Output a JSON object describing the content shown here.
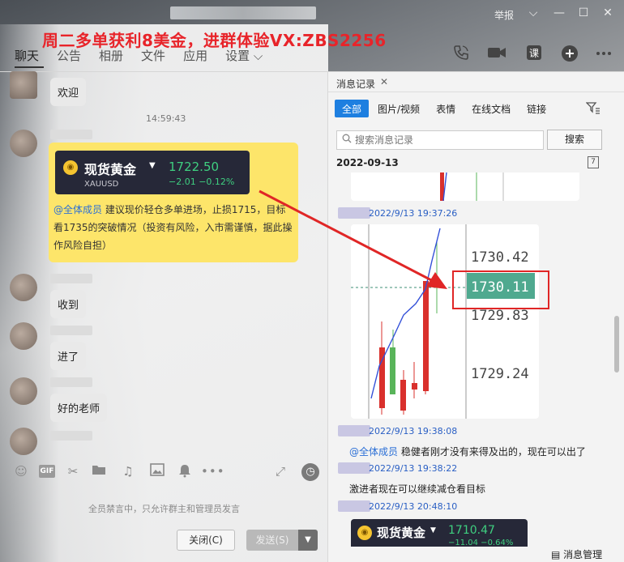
{
  "window": {
    "report_label": "举报",
    "controls": [
      "⌵",
      "—",
      "☐",
      "✕"
    ]
  },
  "promo_text": "周二多单获利8美金，进群体验VX:ZBS2256",
  "nav": {
    "tabs": [
      "聊天",
      "公告",
      "相册",
      "文件",
      "应用",
      "设置 ⌵"
    ]
  },
  "top_icons": [
    "phone-icon",
    "video-icon",
    "course-icon",
    "add-icon",
    "more-icon"
  ],
  "chat": {
    "messages": [
      {
        "text": "欢迎"
      },
      {
        "time": "14:59:43"
      },
      {
        "text": "收到"
      },
      {
        "text": "进了"
      },
      {
        "text": "好的老师"
      }
    ],
    "gold_card": {
      "title": "现货黄金",
      "price": "1722.50",
      "symbol": "XAUUSD",
      "change": "−2.01   −0.12%",
      "mention": "@全体成员",
      "text": "建议现价轻仓多单进场，止损1715，目标看1735的突破情况（投资有风险，入市需谨慎，据此操作风险自担）"
    },
    "toolbar_icons": [
      "emoji-icon",
      "gif-icon",
      "scissors-icon",
      "folder-icon",
      "music-icon",
      "image-icon",
      "bell-icon",
      "more-dots-icon",
      "expand-icon",
      "history-clock-icon"
    ],
    "mute_note": "全员禁言中，只允许群主和管理员发言",
    "close_label": "关闭(C)",
    "send_label": "发送(S)"
  },
  "history": {
    "tab_label": "消息记录",
    "filters": [
      "全部",
      "图片/视频",
      "表情",
      "在线文档",
      "链接"
    ],
    "search_placeholder": "搜索消息记录",
    "search_button": "搜索",
    "date": "2022-09-13",
    "items": [
      {
        "time": "2022/9/13 19:37:26"
      },
      {
        "time": "2022/9/13 19:38:08",
        "mention": "@全体成员",
        "text": "稳健者刚才没有来得及出的，现在可以出了"
      },
      {
        "time": "2022/9/13 19:38:22",
        "text": "激进者现在可以继续减仓看目标"
      },
      {
        "time": "2022/9/13 20:48:10"
      }
    ],
    "chart_prices": {
      "p1": "1730.42",
      "current": "1730.11",
      "p2": "1729.83",
      "p3": "1729.24"
    },
    "bottom_card": {
      "title": "现货黄金",
      "price": "1710.47",
      "change": "−11.04  −0.64%"
    },
    "manage_label": "消息管理"
  },
  "colors": {
    "promo": "#e8242a",
    "accent": "#1e7fe0",
    "up": "#d9302c",
    "down": "#59b45a",
    "price_tag": "#4fa98f"
  }
}
